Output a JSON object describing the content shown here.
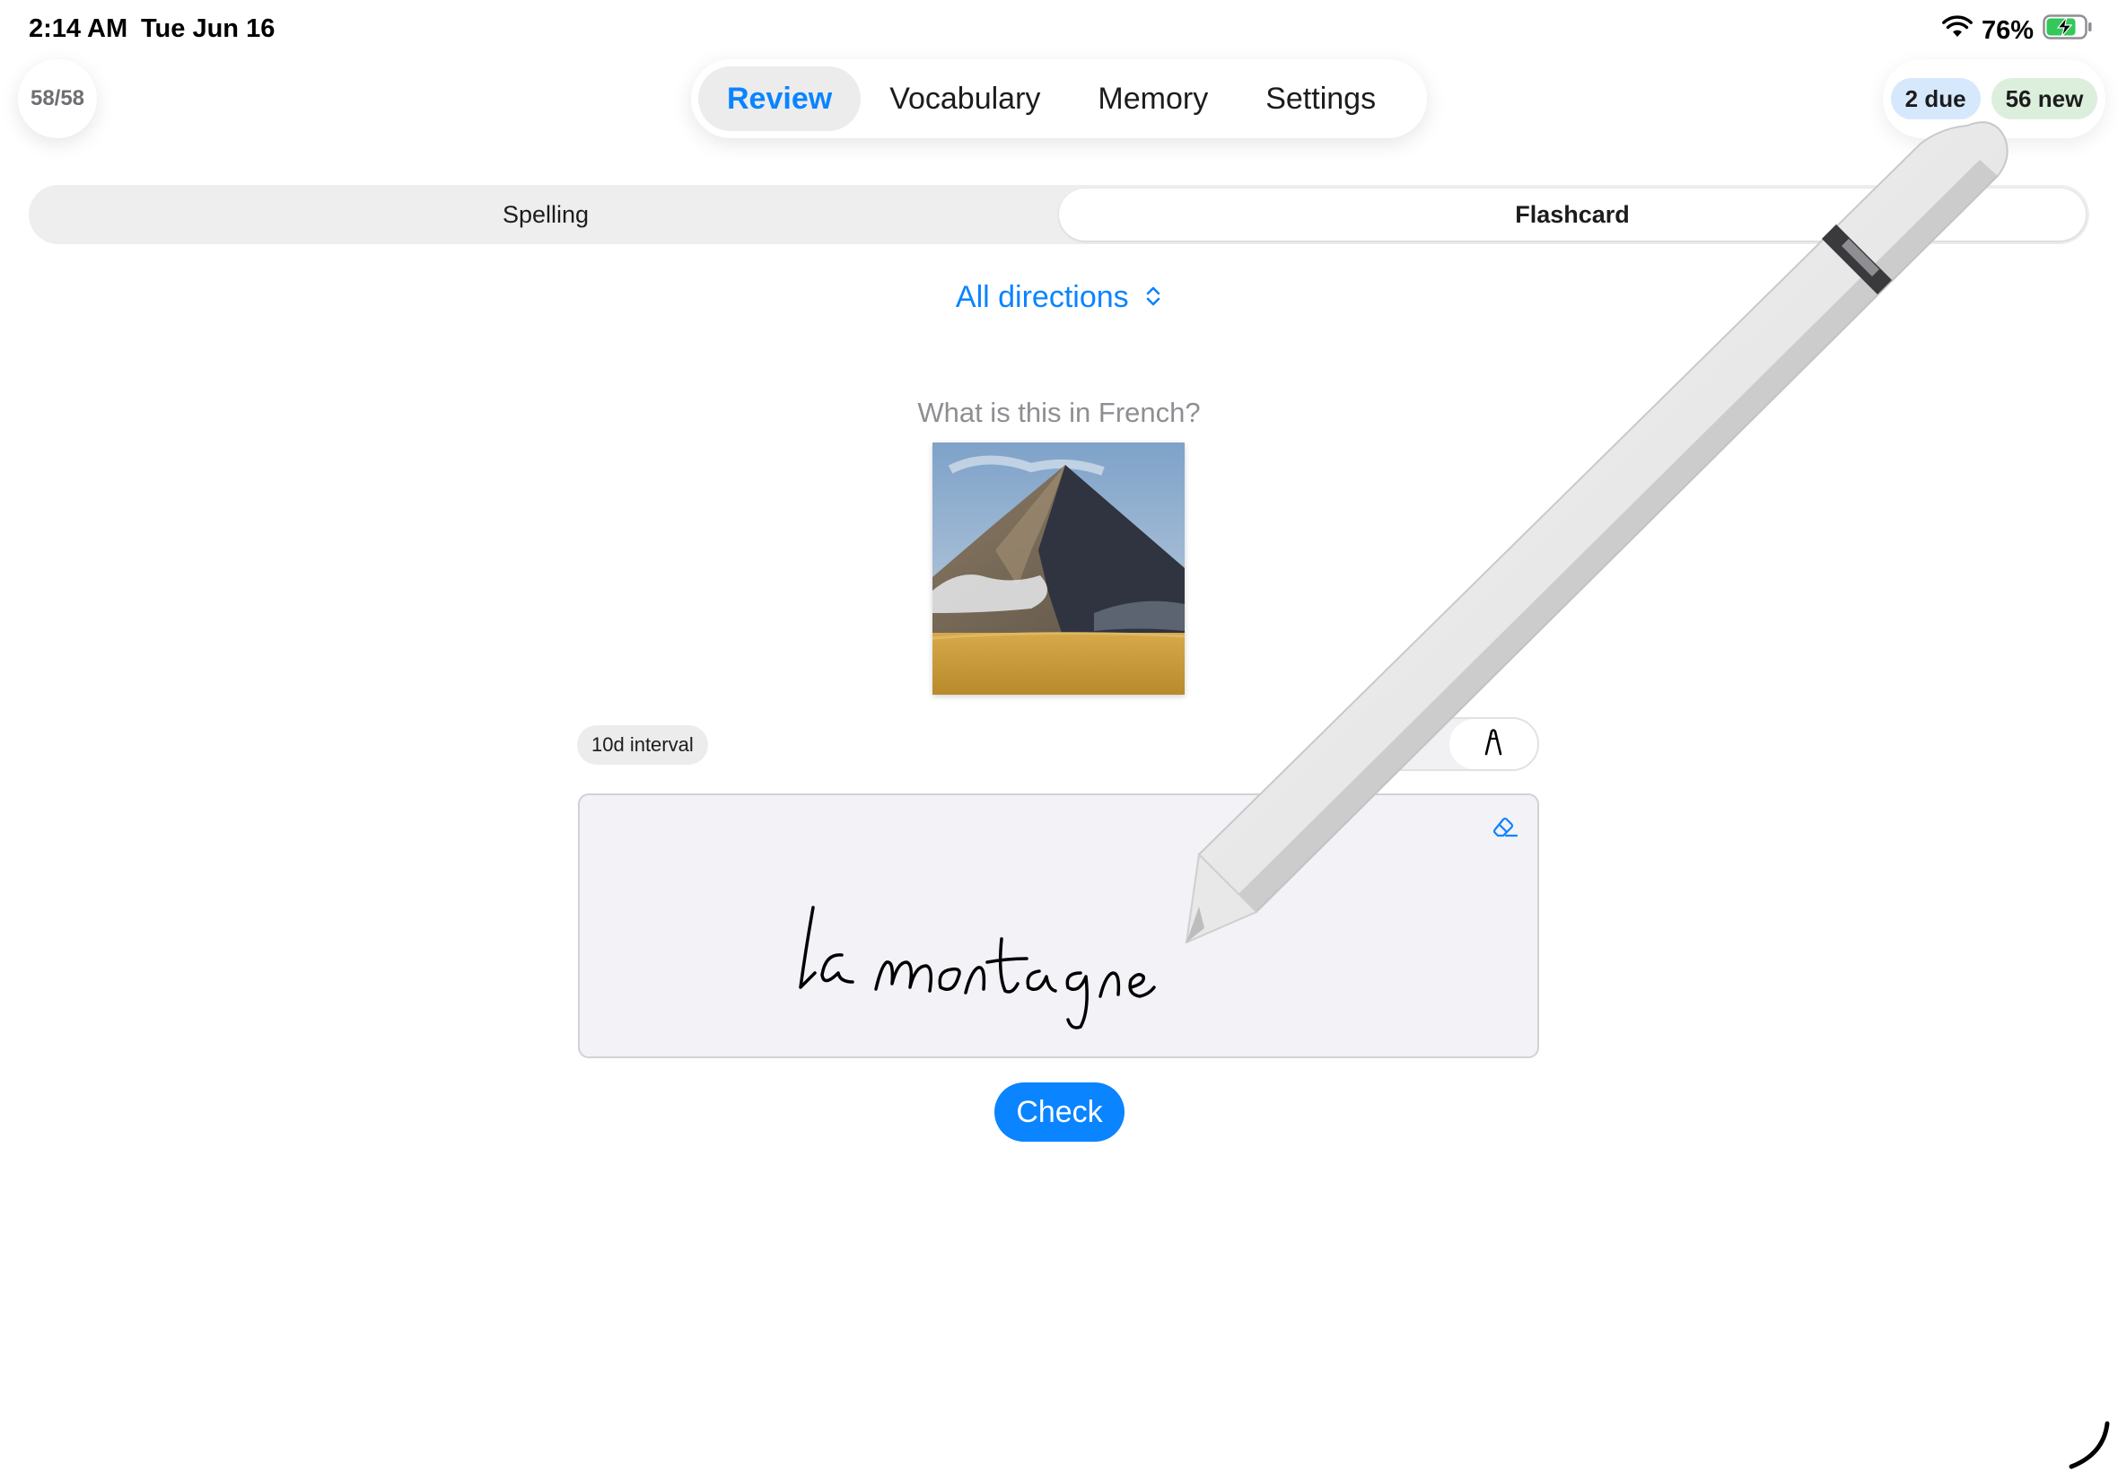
{
  "status_bar": {
    "time": "2:14 AM",
    "date": "Tue Jun 16",
    "battery": "76%"
  },
  "progress": {
    "label": "58/58"
  },
  "tabs": [
    {
      "label": "Review",
      "active": true
    },
    {
      "label": "Vocabulary",
      "active": false
    },
    {
      "label": "Memory",
      "active": false
    },
    {
      "label": "Settings",
      "active": false
    }
  ],
  "badges": {
    "due": "2 due",
    "new": "56 new"
  },
  "mode": {
    "options": [
      "Spelling",
      "Flashcard"
    ],
    "selected": "Flashcard"
  },
  "direction": {
    "label": "All directions"
  },
  "card": {
    "prompt": "What is this in French?",
    "image": "mountain-photo",
    "interval": "10d interval"
  },
  "answer": {
    "handwriting": "la montagne"
  },
  "actions": {
    "check_label": "Check"
  },
  "colors": {
    "accent": "#0a84ff",
    "due_badge": "#d6e8fb",
    "new_badge": "#dcefdc"
  },
  "icons": {
    "wifi": "wifi-icon",
    "battery": "battery-charging-icon",
    "direction": "chevron-up-down-icon",
    "eraser": "eraser-icon",
    "handwriting": "pencil-tip-icon"
  }
}
